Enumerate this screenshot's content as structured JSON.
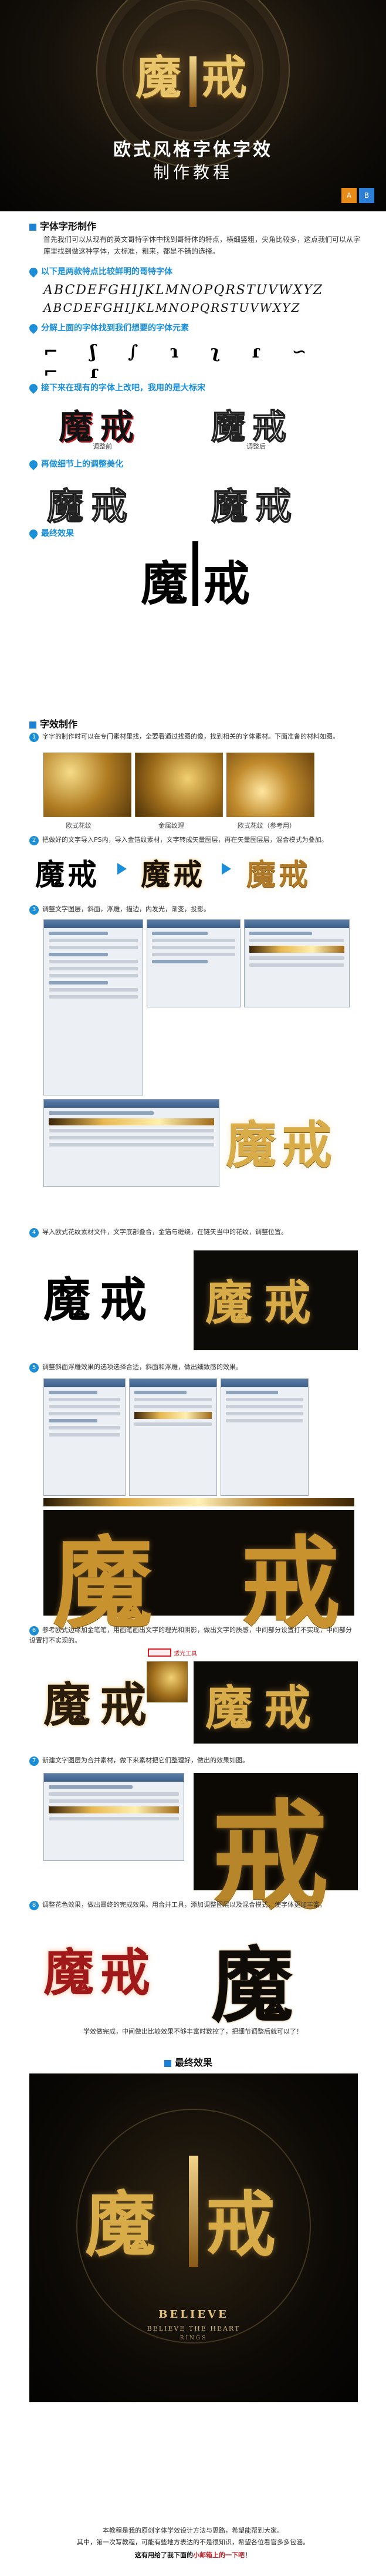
{
  "hero": {
    "logo_left": "魔",
    "logo_right": "戒",
    "title": "欧式风格字体字效",
    "subtitle": "制作教程",
    "btn_a": "A",
    "btn_b": "B"
  },
  "section1": {
    "heading": "字体字形制作",
    "intro": "首先我们可以从现有的英文哥特字体中找到哥特体的特点，横细竖粗，尖角比较多，这点我们可以从字库里找到做这种字体，太标准，粗来，都是不错的选择。",
    "b1": "以下是两款特点比较鲜明的哥特字体",
    "gothic_line1": "ABCDEFGHIJKLMNOPQRSTUVWXYZ",
    "gothic_line2": "ABCDEFGHIJKLMNOPQRSTUVWXYZ",
    "b2": "分解上面的字体找到我们想要的字体元素",
    "glyphs": "⌐ ʃ ∫ ɿ ʅ ɾ ∽ ⌐ ɾ",
    "b3": "接下来在现有的字体上改吧，我用的是大标宋",
    "cap_adjust": "调整前",
    "cap_after": "调整后",
    "b4": "再做细节上的调整美化",
    "b5": "最终效果"
  },
  "section2": {
    "heading": "字效制作",
    "step1": "字字的制作时可以在专门素材里找，全要看通过找图的像，找到相关的字体素材。下面准备的材料如图。",
    "cap_tex1": "欧式花纹",
    "cap_tex2": "金属纹理",
    "cap_tex3": "欧式花纹（参考用）",
    "step2": "把做好的文字导入PS内，导入金箔纹素材，文字转成矢量图层，再在矢量图层层，混合模式为叠加。",
    "step3": "调整文字图层，斜面，浮雕，描边，内发光，渐变，投影。",
    "step4": "导入欧式花纹素材文件，文字底部叠合，金箔与缠绕，在链矢当中的花纹，调整位置。",
    "step5": "调整斜面浮雕效果的选项选择合适，斜面和浮雕，做出细致感的效果。",
    "step6": "参考欧式边缘加金笔笔，用画笔画出文字的理光和阴影，做出文字的质感，中间部分设置打不实现，中间部分设置打不实现的。",
    "step7": "新建文字图层为合并素材，做下来素材把它们整理好，做出的效果如图。",
    "step8": "调整花色效果，做出最终的完成效果。用合并工具，添加调整图层以及混合模式，使字体更加丰富。",
    "note": "学效做完成，中间做出比较效果不够丰富时数控了，把细节调整后就可以了！",
    "red_label": "透光工具",
    "final_heading": "最终效果",
    "final_logo_left": "魔",
    "final_logo_right": "戒",
    "final_en1": "BELIEVE",
    "final_en2": "BELIEVE THE HEART",
    "final_en3": "RINGS"
  },
  "footer": {
    "line1": "本教程是我的原创字体学效设计方法与思路，希望能帮到大家。",
    "line2": "其中，第一次写教程，可能有些地方表达的不是很知识，希望各位看官多多包涵。",
    "line3_pre": "这有用给了我下面的",
    "line3_hl": "小邮箱上的一下吧",
    "line3_post": "！"
  },
  "colors": {
    "accent": "#1a8fd8",
    "gold": "#d9ac4a",
    "hero_bg": "#14100a",
    "btn_a": "#e88a18",
    "btn_b": "#2d7fd6"
  }
}
